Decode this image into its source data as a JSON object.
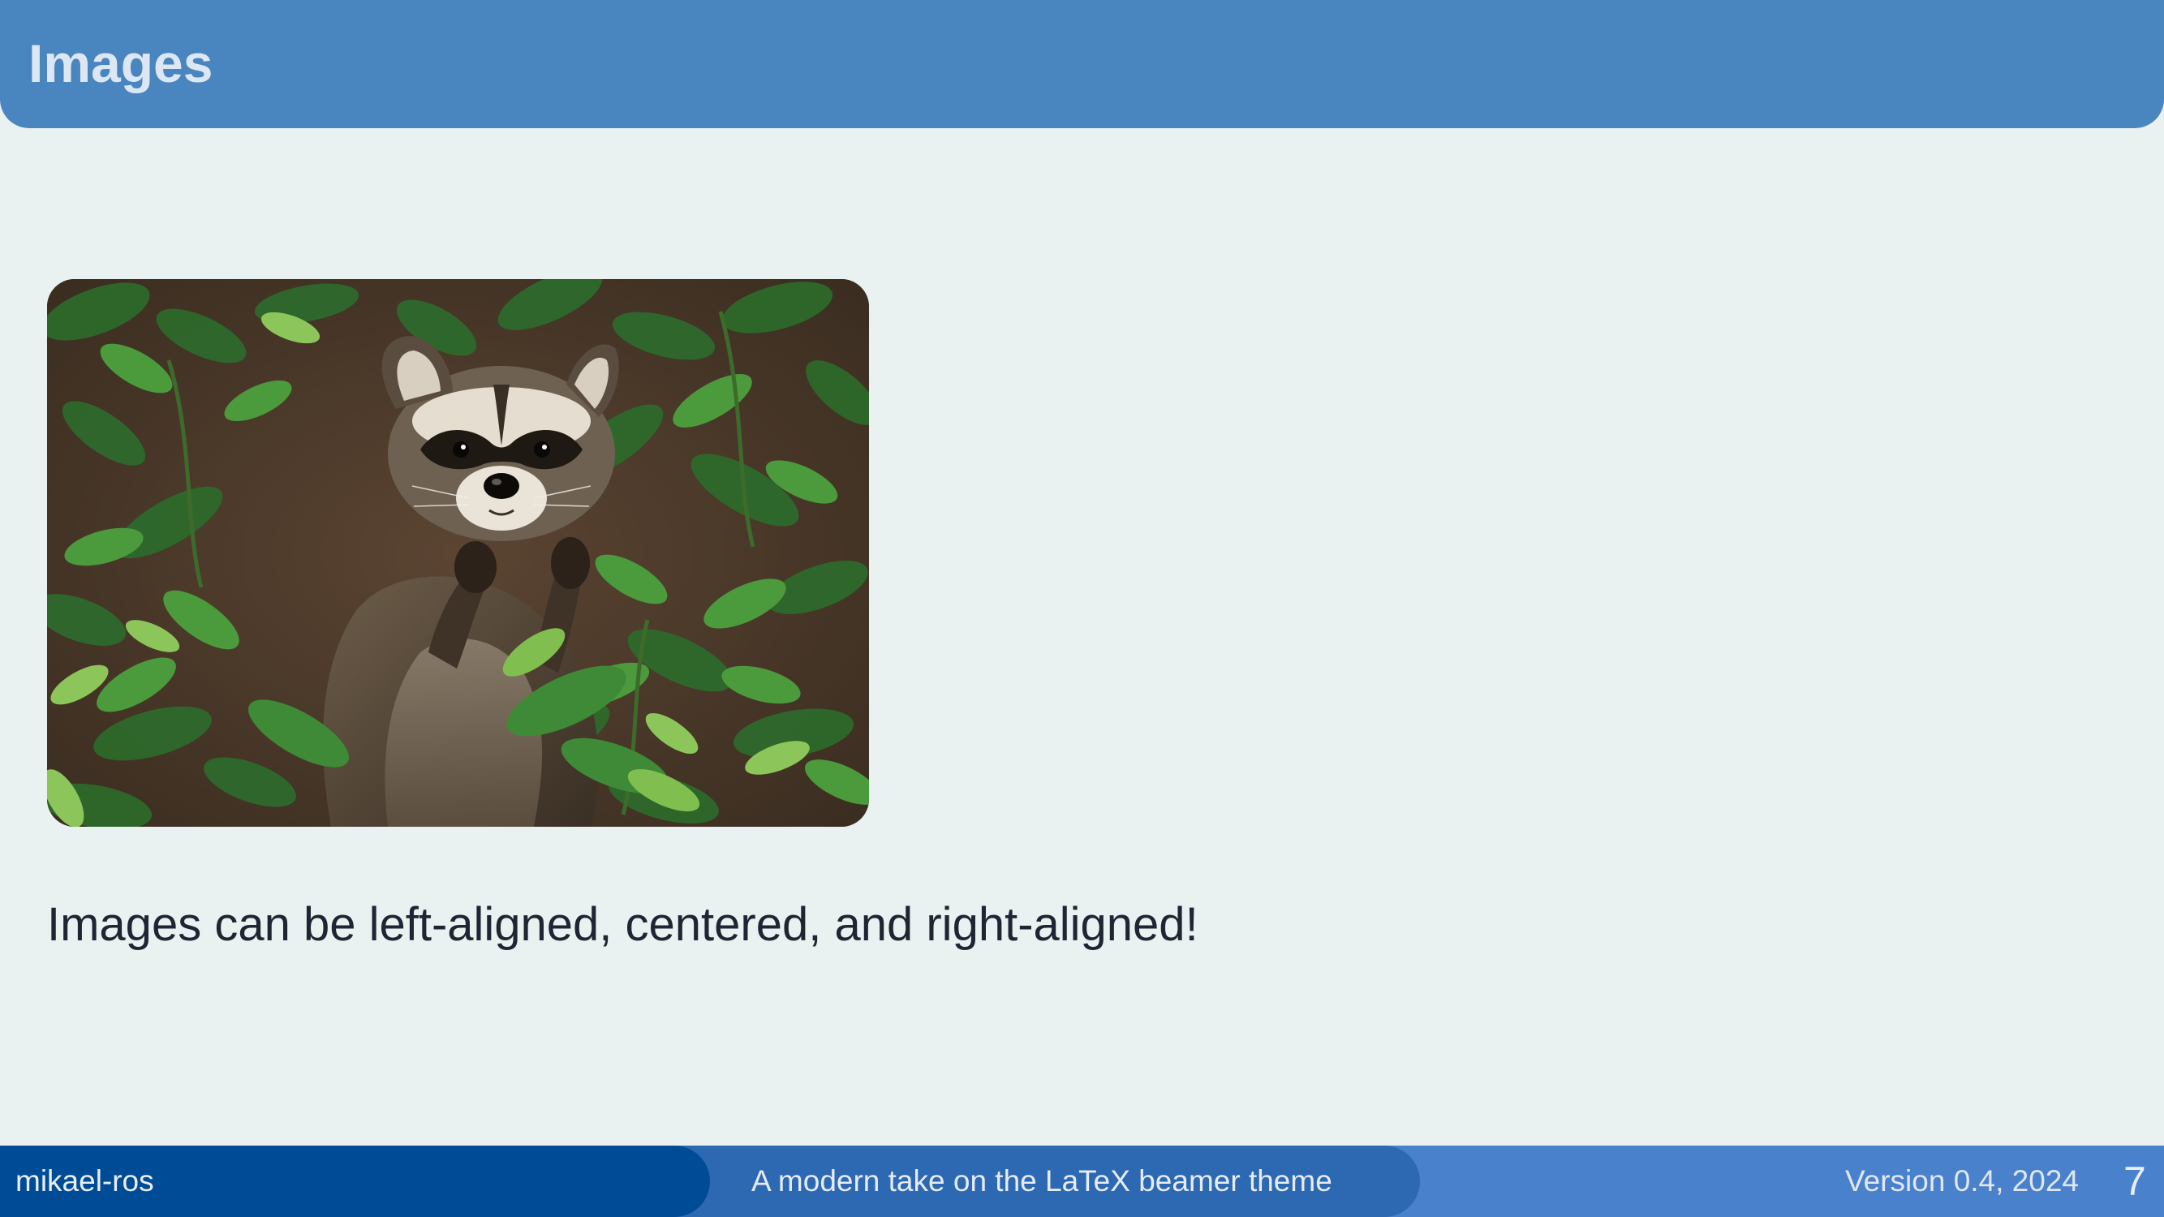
{
  "header": {
    "title": "Images"
  },
  "main": {
    "image": {
      "subject": "raccoon-photo"
    },
    "body_text": "Images can be left-aligned, centered, and right-aligned!"
  },
  "footer": {
    "author": "mikael-ros",
    "subtitle": "A modern take on the LaTeX beamer theme",
    "version": "Version 0.4, 2024",
    "page_number": "7"
  },
  "colors": {
    "background": "#e9f1f1",
    "header": "#4985bf",
    "header_text": "#dde7f4",
    "body_text": "#1f2533",
    "footer_left": "#004b96",
    "footer_middle": "#2d68b3",
    "footer_right": "#4a81cc"
  }
}
